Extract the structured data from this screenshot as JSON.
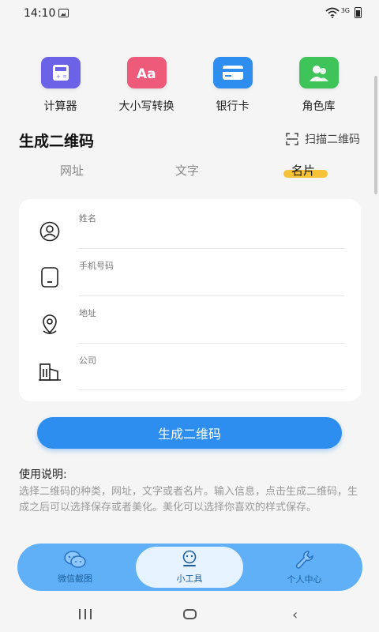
{
  "status_bar": {
    "time": "14:10",
    "network": "3G"
  },
  "tools": [
    {
      "label": "计算器",
      "color": "#6b62e8",
      "icon": "calculator-icon"
    },
    {
      "label": "大小写转换",
      "color": "#ee5a7a",
      "icon": "text-case-icon"
    },
    {
      "label": "银行卡",
      "color": "#2e8ef0",
      "icon": "bank-card-icon"
    },
    {
      "label": "角色库",
      "color": "#3fc45a",
      "icon": "contacts-icon"
    }
  ],
  "section": {
    "title": "生成二维码",
    "scan_label": "扫描二维码"
  },
  "tabs": [
    {
      "label": "网址",
      "active": false
    },
    {
      "label": "文字",
      "active": false
    },
    {
      "label": "名片",
      "active": true
    }
  ],
  "form": {
    "fields": [
      {
        "label": "姓名",
        "icon": "person-icon"
      },
      {
        "label": "手机号码",
        "icon": "phone-icon"
      },
      {
        "label": "地址",
        "icon": "location-icon"
      },
      {
        "label": "公司",
        "icon": "building-icon"
      }
    ]
  },
  "generate_button": "生成二维码",
  "instructions": {
    "title": "使用说明:",
    "text": "选择二维码的种类，网址，文字或者名片。输入信息，点击生成二维码，生成之后可以选择保存或者美化。美化可以选择你喜欢的样式保存。"
  },
  "bottom_nav": [
    {
      "label": "微信截图",
      "icon": "wechat-icon",
      "active": false
    },
    {
      "label": "小工具",
      "icon": "robot-icon",
      "active": true
    },
    {
      "label": "个人中心",
      "icon": "wrench-icon",
      "active": false
    }
  ],
  "colors": {
    "accent": "#2e8ef0",
    "tab_highlight": "#f5c238",
    "nav_bg": "#5fb0f6"
  }
}
